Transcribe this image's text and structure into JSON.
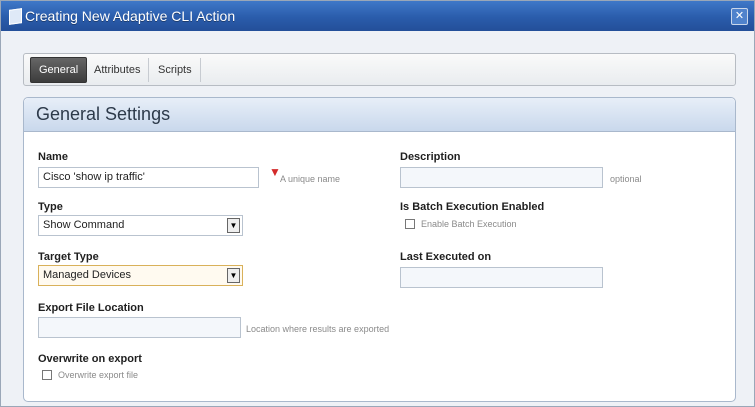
{
  "window": {
    "title": "Creating New Adaptive CLI Action",
    "close_glyph": "✕"
  },
  "tabs": [
    {
      "label": "General",
      "active": true
    },
    {
      "label": "Attributes",
      "active": false
    },
    {
      "label": "Scripts",
      "active": false
    }
  ],
  "panel": {
    "title": "General Settings"
  },
  "form": {
    "name": {
      "label": "Name",
      "value": "Cisco 'show ip traffic'",
      "hint": "A unique name"
    },
    "description": {
      "label": "Description",
      "value": "",
      "hint": "optional"
    },
    "type": {
      "label": "Type",
      "value": "Show Command"
    },
    "batch": {
      "label": "Is Batch Execution Enabled",
      "checkbox_label": "Enable Batch Execution",
      "checked": false
    },
    "target_type": {
      "label": "Target Type",
      "value": "Managed Devices"
    },
    "last_executed": {
      "label": "Last Executed on",
      "value": ""
    },
    "export_location": {
      "label": "Export File Location",
      "value": "",
      "hint": "Location where results are exported"
    },
    "overwrite": {
      "label": "Overwrite on export",
      "checkbox_label": "Overwrite export file",
      "checked": false
    }
  },
  "colors": {
    "titlebar": "#2a5cab",
    "panel_header": "#c9d8ec",
    "required": "#d32a2a"
  }
}
